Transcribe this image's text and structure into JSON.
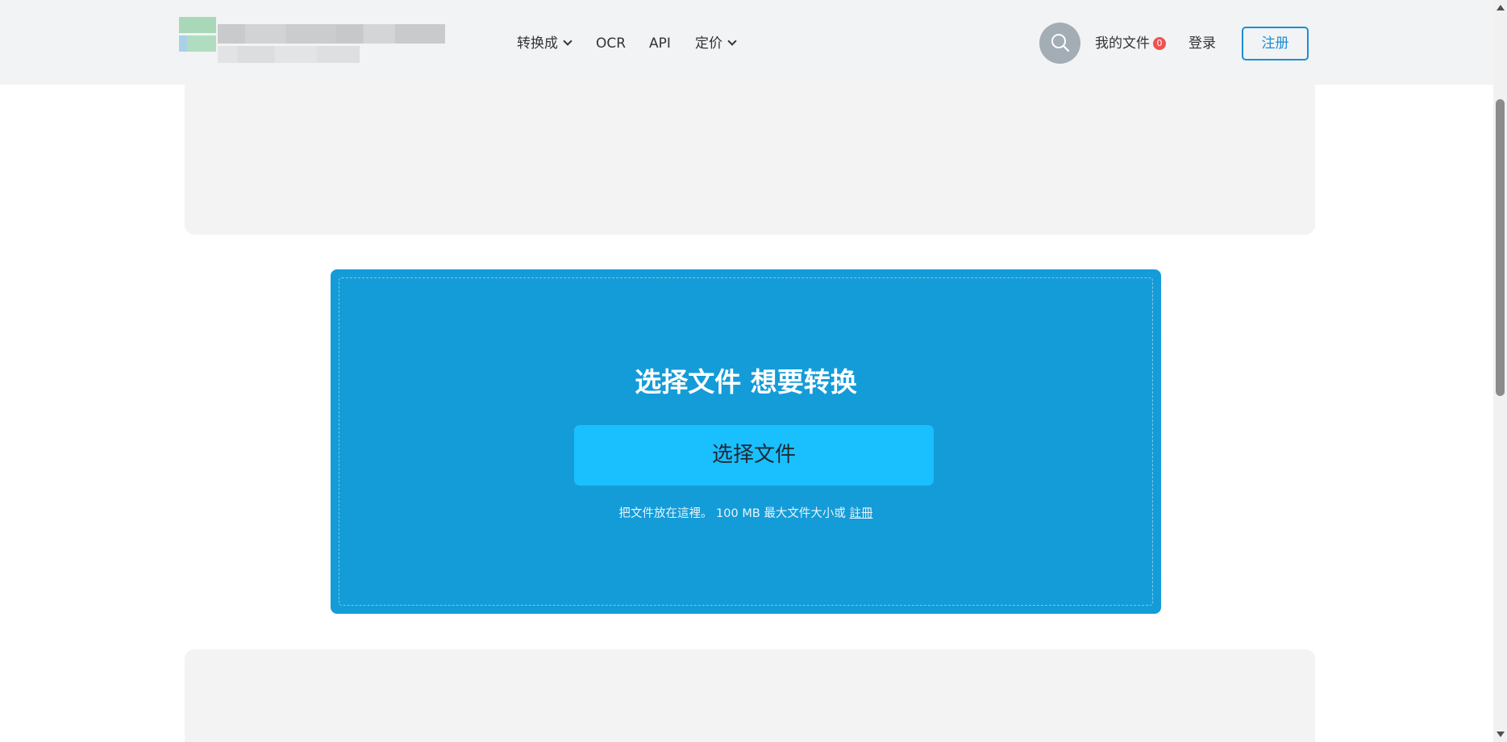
{
  "header": {
    "nav": [
      {
        "label": "转换成",
        "dropdown": true
      },
      {
        "label": "OCR",
        "dropdown": false
      },
      {
        "label": "API",
        "dropdown": false
      },
      {
        "label": "定价",
        "dropdown": true
      }
    ],
    "my_files_label": "我的文件",
    "my_files_count": "0",
    "login_label": "登录",
    "register_label": "注册"
  },
  "upload": {
    "title": "选择文件 想要转换",
    "choose_button": "选择文件",
    "hint_text": "把文件放在這裡。 100 MB 最大文件大小或",
    "hint_link": "註冊"
  },
  "colors": {
    "accent": "#149cd8",
    "button": "#1abffd",
    "register_border": "#1a8fd6",
    "badge": "#ef5350",
    "header_bg": "#f2f3f4"
  },
  "icons": {
    "search": "search-icon",
    "dropdown": "chevron-down-icon"
  }
}
